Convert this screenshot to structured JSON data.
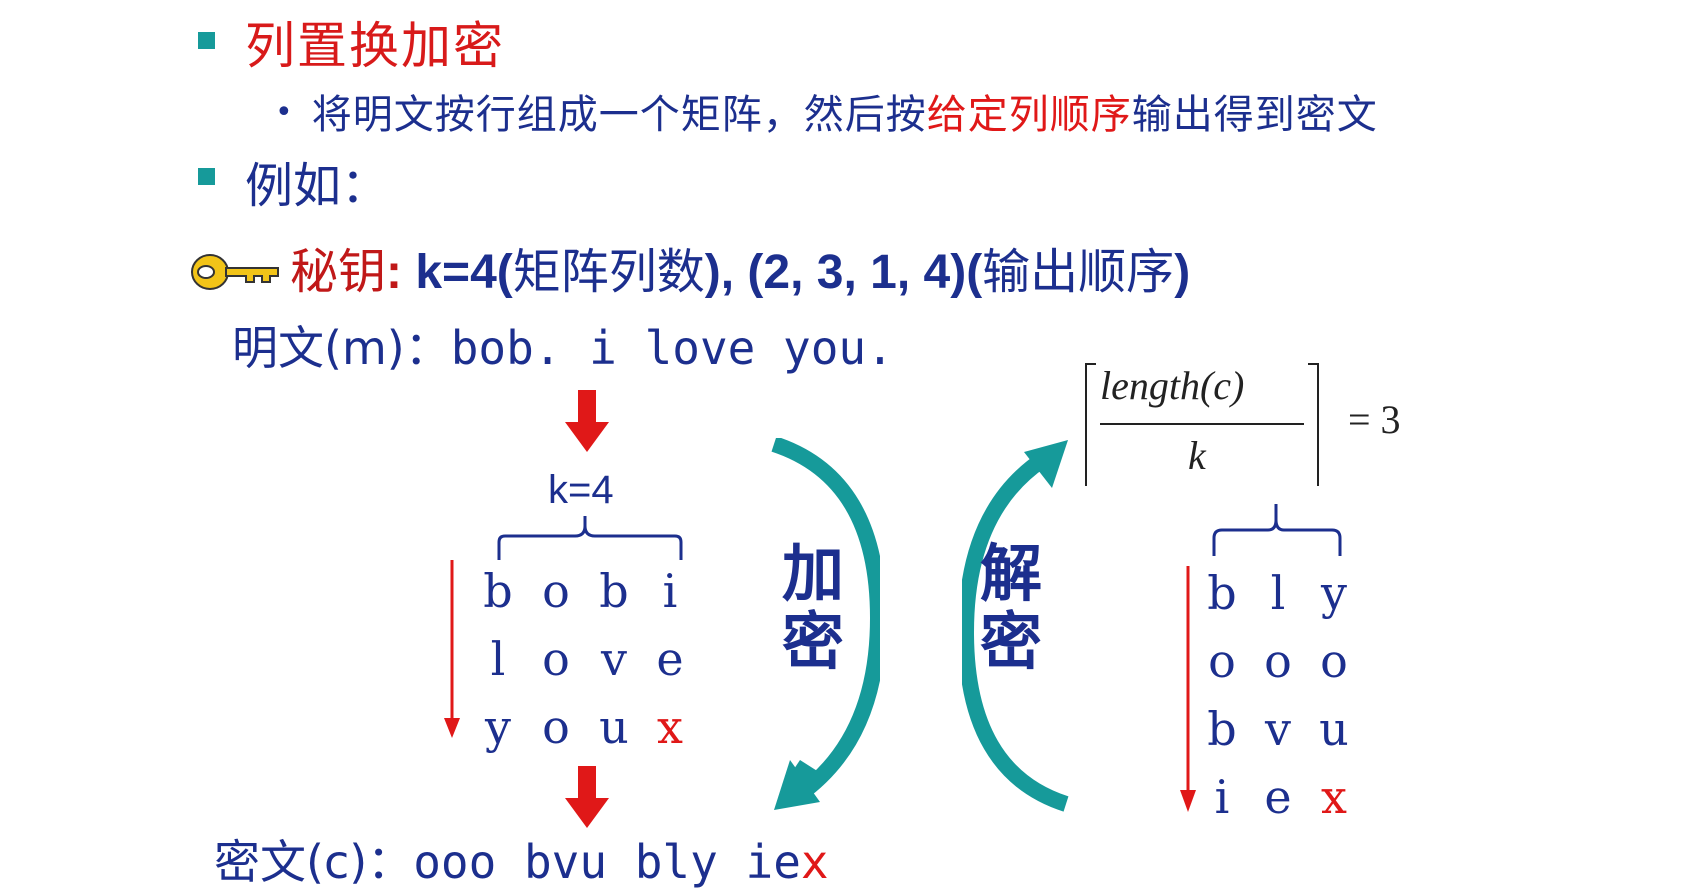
{
  "title": "列置换加密",
  "bullet_sub": {
    "before": "将明文按行组成一个矩阵，然后按",
    "highlight": "给定列顺序",
    "after": "输出得到密文"
  },
  "example_label": "例如：",
  "key_line": {
    "label": "秘钥",
    "colon": ":",
    "k_part": " k=4(",
    "k_desc": "矩阵列数",
    "mid": "), (2, 3, 1, 4)(",
    "order_desc": "输出顺序",
    "end": ")"
  },
  "plaintext": {
    "label": "明文(m)：",
    "value": "bob. i love you."
  },
  "k4_label": "k=4",
  "enc_matrix": [
    [
      "b",
      "o",
      "b",
      "i"
    ],
    [
      "l",
      "o",
      "v",
      "e"
    ],
    [
      "y",
      "o",
      "u",
      "x"
    ]
  ],
  "dec_matrix": [
    [
      "b",
      "l",
      "y"
    ],
    [
      "o",
      "o",
      "o"
    ],
    [
      "b",
      "v",
      "u"
    ],
    [
      "i",
      "e",
      "x"
    ]
  ],
  "encrypt_label": [
    "加",
    "密"
  ],
  "decrypt_label": [
    "解",
    "密"
  ],
  "formula": {
    "numerator": "length(c)",
    "denominator": "k",
    "equals": "= 3"
  },
  "ciphertext": {
    "label": "密文(c)：",
    "value": "ooo bvu bly ie",
    "pad": "x"
  },
  "colors": {
    "navy": "#1c2f8e",
    "red": "#e01818",
    "teal": "#169a9a",
    "key_gold": "#f2c418"
  },
  "icons": [
    "key-icon",
    "down-arrow-icon",
    "curved-arrow-icon",
    "brace-icon"
  ]
}
